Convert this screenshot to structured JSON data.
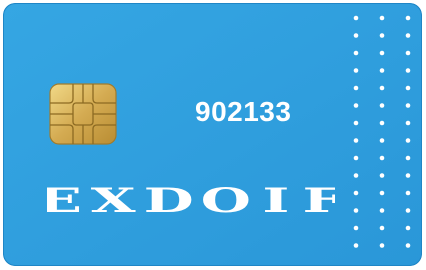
{
  "card": {
    "number": "902133",
    "brand_letters": [
      "E",
      "X",
      "D",
      "O",
      "I",
      "F"
    ],
    "colors": {
      "background": "#2e9fde",
      "background_dark": "#1f86c6",
      "text": "#ffffff",
      "chip_gold": "#d9b35a",
      "chip_line": "#9a7426"
    },
    "icons": [
      "chip-icon",
      "dot-pattern"
    ]
  }
}
